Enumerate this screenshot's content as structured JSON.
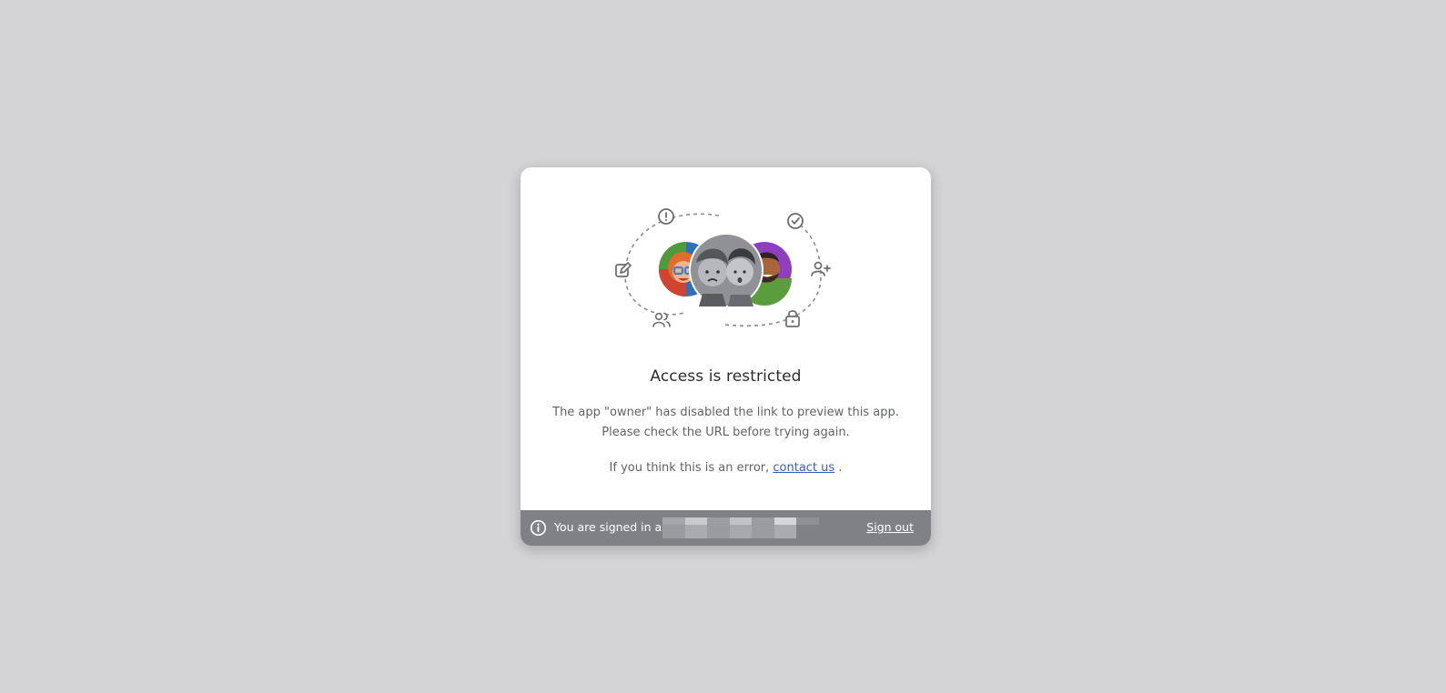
{
  "dialog": {
    "title": "Access is restricted",
    "message_line1": "The app \"owner\" has disabled the link to preview this app.",
    "message_line2": "Please check the URL before trying again.",
    "error_prefix": "If you think this is an error, ",
    "contact_link": "contact us",
    "error_suffix": " ."
  },
  "footer": {
    "signed_in_text": "You are signed in as",
    "sign_out_label": "Sign out"
  },
  "colors": {
    "background": "#d4d4d6",
    "footer": "#7f8187",
    "link": "#3a5bb8"
  },
  "icons": [
    "exclamation-circle-icon",
    "check-circle-icon",
    "edit-icon",
    "add-user-icon",
    "users-icon",
    "lock-icon",
    "info-icon"
  ]
}
